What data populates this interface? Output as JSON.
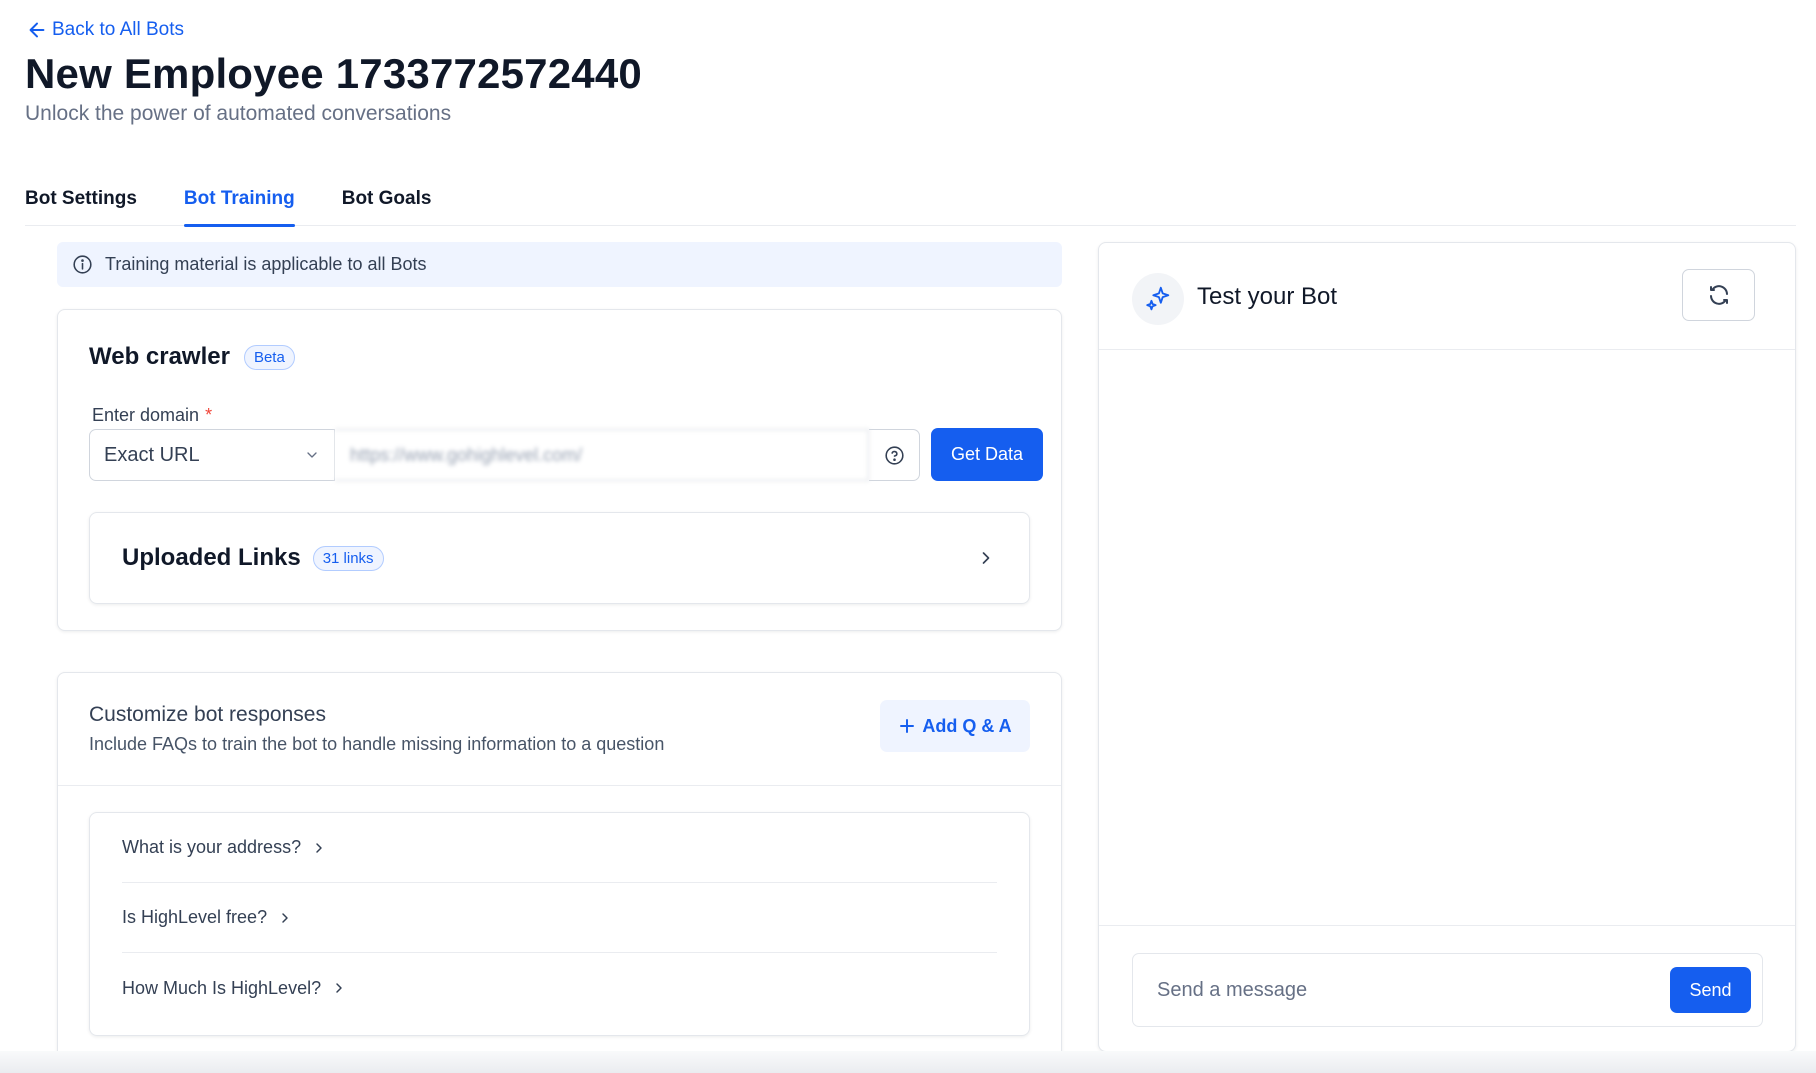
{
  "header": {
    "back_label": "Back to All Bots",
    "title": "New Employee 1733772572440",
    "subtitle": "Unlock the power of automated conversations"
  },
  "tabs": [
    {
      "label": "Bot Settings",
      "active": false
    },
    {
      "label": "Bot Training",
      "active": true
    },
    {
      "label": "Bot Goals",
      "active": false
    }
  ],
  "banner": {
    "text": "Training material is applicable to all Bots",
    "icon": "info-icon"
  },
  "web_crawler": {
    "title": "Web crawler",
    "badge": "Beta",
    "domain_label": "Enter domain",
    "required_mark": "*",
    "match_type": "Exact URL",
    "url_value": "https://www.gohighlevel.com/",
    "get_data_label": "Get Data",
    "uploaded_links": {
      "title": "Uploaded Links",
      "count_label": "31 links"
    }
  },
  "responses": {
    "title": "Customize bot responses",
    "description": "Include FAQs to train the bot to handle missing information to a question",
    "add_label": "Add Q & A",
    "questions": [
      {
        "text": "What is your address?"
      },
      {
        "text": "Is HighLevel free?"
      },
      {
        "text": "How Much Is HighLevel?"
      }
    ]
  },
  "test_bot": {
    "title": "Test your Bot",
    "message_placeholder": "Send a message",
    "send_label": "Send"
  },
  "colors": {
    "accent": "#155eef",
    "accent_light": "#eff4ff",
    "text_primary": "#101828",
    "text_secondary": "#667085",
    "border": "#e4e7ec"
  }
}
